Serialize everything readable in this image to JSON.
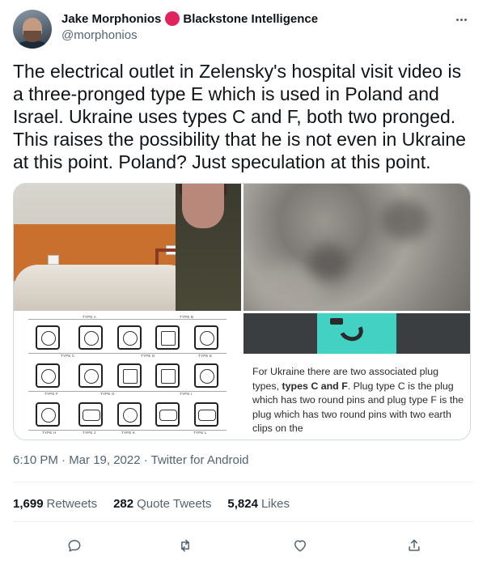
{
  "author": {
    "display_name": "Jake Morphonios",
    "affiliation": "Blackstone Intelligence",
    "handle": "@morphonios",
    "badge_color": "#e0245e"
  },
  "tweet": {
    "text": "The electrical outlet in Zelensky's hospital visit video is a three-pronged type E which is used in Poland and Israel. Ukraine uses types C and F, both two pronged. This raises the possibility that he is not even in Ukraine at this point. Poland? Just speculation at this point."
  },
  "media": {
    "plug_chart": {
      "type_labels": [
        "TYPE A",
        "TYPE B",
        "TYPE C",
        "TYPE D",
        "TYPE E",
        "TYPE F",
        "TYPE G",
        "TYPE I",
        "TYPE H",
        "TYPE J",
        "TYPE K",
        "TYPE L"
      ]
    },
    "caption": {
      "part1": "For Ukraine there are two associated plug types, ",
      "bold": "types C and F",
      "part2": ". Plug type C is the plug which has two round pins and plug type F is the plug which has two round pins with two earth clips on the"
    }
  },
  "meta": {
    "timestamp": "6:10 PM · Mar 19, 2022 · Twitter for Android"
  },
  "stats": {
    "retweets_count": "1,699",
    "retweets_label": "Retweets",
    "quotes_count": "282",
    "quotes_label": "Quote Tweets",
    "likes_count": "5,824",
    "likes_label": "Likes"
  },
  "icons": {
    "reply": "reply-icon",
    "retweet": "retweet-icon",
    "like": "heart-icon",
    "share": "share-icon",
    "more": "more-icon"
  },
  "colors": {
    "text_primary": "#0f1419",
    "text_secondary": "#536471",
    "border": "#cfd9de"
  }
}
